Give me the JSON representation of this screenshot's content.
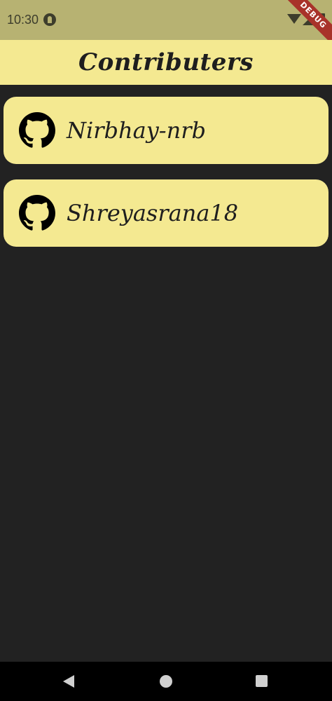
{
  "status_bar": {
    "time": "10:30"
  },
  "debug_banner": {
    "label": "DEBUG"
  },
  "app_bar": {
    "title": "Contributers"
  },
  "contributors": [
    {
      "name": "Nirbhay-nrb",
      "icon": "github-icon"
    },
    {
      "name": "Shreyasrana18",
      "icon": "github-icon"
    }
  ],
  "colors": {
    "status_bar": "#b7b272",
    "card_bg": "#f4e991",
    "page_bg": "#222222",
    "text": "#1e1e1e",
    "nav_bar": "#000000",
    "debug_banner": "#a8322a"
  }
}
